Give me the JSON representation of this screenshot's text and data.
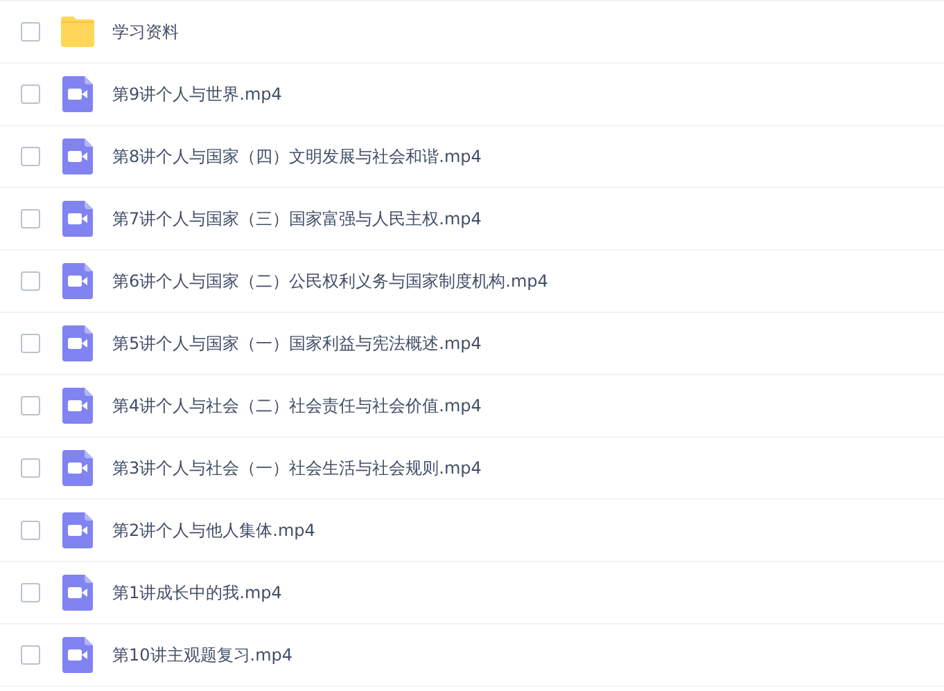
{
  "files": [
    {
      "kind": "folder",
      "name": "学习资料",
      "checked": false
    },
    {
      "kind": "video",
      "name": "第9讲个人与世界.mp4",
      "checked": false
    },
    {
      "kind": "video",
      "name": "第8讲个人与国家（四）文明发展与社会和谐.mp4",
      "checked": false
    },
    {
      "kind": "video",
      "name": "第7讲个人与国家（三）国家富强与人民主权.mp4",
      "checked": false
    },
    {
      "kind": "video",
      "name": "第6讲个人与国家（二）公民权利义务与国家制度机构.mp4",
      "checked": false
    },
    {
      "kind": "video",
      "name": "第5讲个人与国家（一）国家利益与宪法概述.mp4",
      "checked": false
    },
    {
      "kind": "video",
      "name": "第4讲个人与社会（二）社会责任与社会价值.mp4",
      "checked": false
    },
    {
      "kind": "video",
      "name": "第3讲个人与社会（一）社会生活与社会规则.mp4",
      "checked": false
    },
    {
      "kind": "video",
      "name": "第2讲个人与他人集体.mp4",
      "checked": false
    },
    {
      "kind": "video",
      "name": "第1讲成长中的我.mp4",
      "checked": false
    },
    {
      "kind": "video",
      "name": "第10讲主观题复习.mp4",
      "checked": false
    }
  ]
}
